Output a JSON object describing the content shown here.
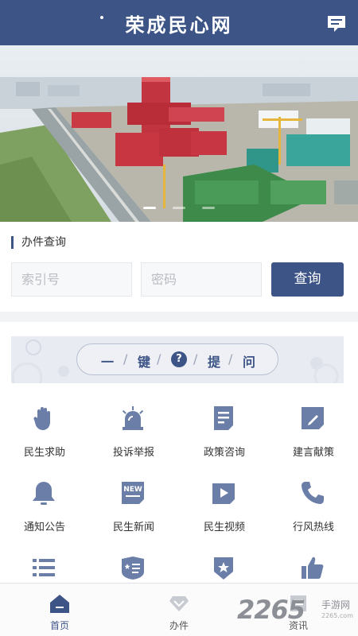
{
  "header": {
    "title": "荣成民心网",
    "message_icon": "message-icon"
  },
  "banner": {
    "image": "city-aerial-photo",
    "slides": 3,
    "active_slide": 0
  },
  "query": {
    "section_title": "办件查询",
    "index_placeholder": "索引号",
    "password_placeholder": "密码",
    "search_label": "查询"
  },
  "ask": {
    "chars": [
      "一",
      "键",
      "提",
      "问"
    ],
    "qmark": "?"
  },
  "services": [
    {
      "label": "民生求助",
      "icon": "hand-icon"
    },
    {
      "label": "投诉举报",
      "icon": "alarm-light-icon"
    },
    {
      "label": "政策咨询",
      "icon": "document-icon"
    },
    {
      "label": "建言献策",
      "icon": "pencil-icon"
    },
    {
      "label": "通知公告",
      "icon": "bell-icon"
    },
    {
      "label": "民生新闻",
      "icon": "news-icon"
    },
    {
      "label": "民生视频",
      "icon": "video-icon"
    },
    {
      "label": "行风热线",
      "icon": "phone-icon"
    },
    {
      "label": "",
      "icon": "list-icon"
    },
    {
      "label": "",
      "icon": "badge-icon"
    },
    {
      "label": "",
      "icon": "star-shield-icon"
    },
    {
      "label": "",
      "icon": "thumbs-up-icon"
    }
  ],
  "bottom_nav": [
    {
      "label": "首页",
      "icon": "home-icon",
      "active": true
    },
    {
      "label": "办件",
      "icon": "diamond-icon",
      "active": false
    },
    {
      "label": "资讯",
      "icon": "info-icon",
      "active": false
    }
  ],
  "watermark": {
    "number": "2265",
    "text": "手游网",
    "url": "2265.com"
  },
  "colors": {
    "primary": "#3d5486",
    "icon": "#6a7ea8"
  }
}
